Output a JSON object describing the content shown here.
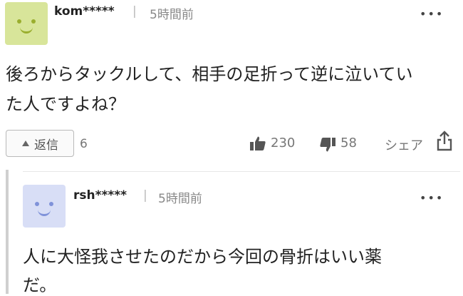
{
  "comment": {
    "username": "kom*****",
    "separator": "|",
    "time": "5時間前",
    "more": "•••",
    "body_line1": "後ろからタックルして、相手の足折って逆に泣いてい",
    "body_line2": "た人ですよね？",
    "reply_label": "返信",
    "reply_count": "6",
    "like_count": "230",
    "dislike_count": "58",
    "share_label": "シェア",
    "avatar_color": "#d8e59a",
    "avatar_face_color": "#9aae2e"
  },
  "reply": {
    "username": "rsh*****",
    "separator": "|",
    "time": "5時間前",
    "more": "•••",
    "body_line1": "人に大怪我させたのだから今回の骨折はいい薬",
    "body_line2": "だ。",
    "avatar_color": "#d8def6",
    "avatar_face_color": "#7f92d9"
  }
}
